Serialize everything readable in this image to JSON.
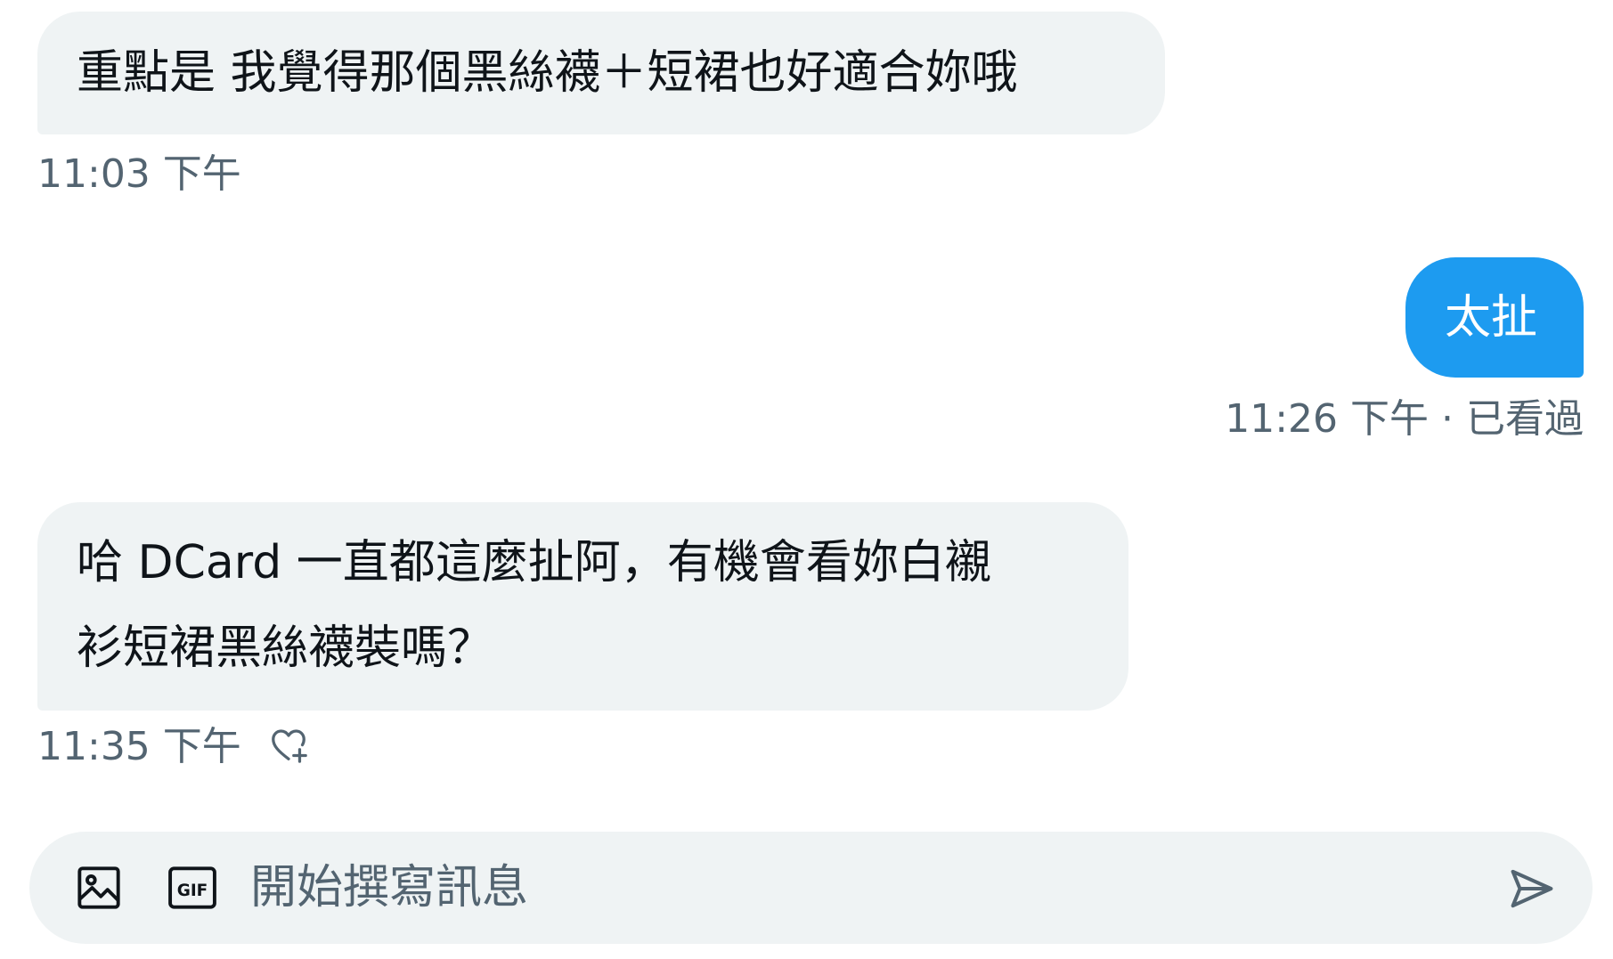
{
  "conversation": {
    "messages": [
      {
        "direction": "received",
        "lines": [
          "重點是 我覺得那個黑絲襪＋短裙也好適合妳哦"
        ],
        "time": "11:03 下午"
      },
      {
        "direction": "sent",
        "lines": [
          "太扯"
        ],
        "time": "11:26 下午",
        "status": "已看過",
        "separator": "·"
      },
      {
        "direction": "received",
        "lines": [
          "哈 DCard 一直都這麼扯阿，有機會看妳白襯",
          "衫短裙黑絲襪裝嗎？"
        ],
        "time": "11:35 下午",
        "reaction_icon": "heart-plus-icon"
      }
    ]
  },
  "composer": {
    "placeholder": "開始撰寫訊息",
    "icons": [
      "image-icon",
      "gif-icon",
      "send-icon"
    ]
  },
  "colors": {
    "sent_bubble": "#1d9bf0",
    "received_bubble": "#eff3f4",
    "meta_text": "#536471",
    "composer_bg": "#eff3f4"
  }
}
